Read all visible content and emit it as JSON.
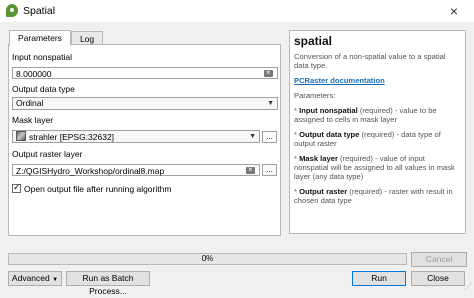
{
  "window": {
    "title": "Spatial",
    "close_glyph": "×"
  },
  "tabs": [
    {
      "label": "Parameters"
    },
    {
      "label": "Log"
    }
  ],
  "form": {
    "input_label": "Input nonspatial",
    "input_value": "8.000000",
    "datatype_label": "Output data type",
    "datatype_value": "Ordinal",
    "mask_label": "Mask layer",
    "mask_value": "strahler [EPSG:32632]",
    "output_label": "Output raster layer",
    "output_value": "Z:/QGISHydro_Workshop/ordinal8.map",
    "open_checkbox_label": "Open output file after running algorithm",
    "browse_label": "..."
  },
  "help": {
    "title": "spatial",
    "description": "Conversion of a non-spatial value to a spatial data type.",
    "doc_link": "PCRaster documentation",
    "params_heading": "Parameters:",
    "params": [
      {
        "name": "Input nonspatial",
        "text": " (required) - value to be assigned to cells in mask layer"
      },
      {
        "name": "Output data type",
        "text": " (required) - data type of output raster"
      },
      {
        "name": "Mask layer",
        "text": " (required) - value of input nonspatial will be assigned to all values in mask layer (any data type)"
      },
      {
        "name": "Output raster",
        "text": " (required) - raster with result in chosen data type"
      }
    ]
  },
  "progress": {
    "value": 0,
    "label": "0%"
  },
  "buttons": {
    "cancel": "Cancel",
    "advanced": "Advanced",
    "batch": "Run as Batch Process...",
    "run": "Run",
    "close": "Close"
  }
}
